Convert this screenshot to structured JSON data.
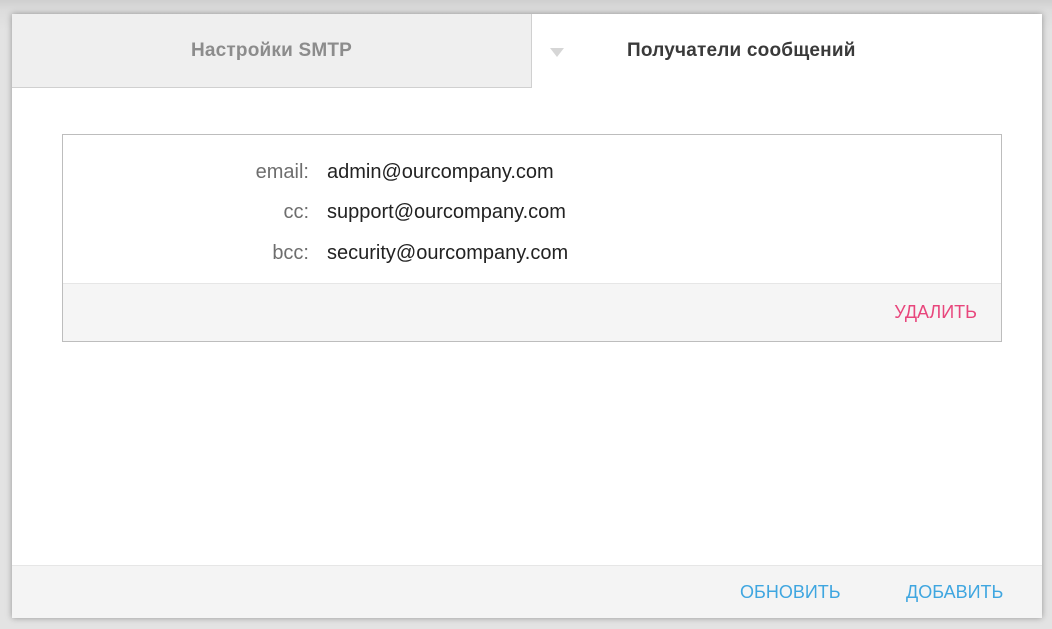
{
  "tabs": {
    "smtp_label": "Настройки SMTP",
    "recipients_label": "Получатели сообщений",
    "active": "recipients",
    "arrow_icon": "triangle-down-icon"
  },
  "recipient": {
    "fields": [
      {
        "key": "email:",
        "value": "admin@ourcompany.com"
      },
      {
        "key": "cc:",
        "value": "support@ourcompany.com"
      },
      {
        "key": "bcc:",
        "value": "security@ourcompany.com"
      }
    ],
    "delete_label": "УДАЛИТЬ"
  },
  "footer": {
    "refresh_label": "ОБНОВИТЬ",
    "add_label": "ДОБАВИТЬ"
  },
  "colors": {
    "delete": "#e8467c",
    "action": "#3fa6e0",
    "inactive_tab_bg": "#efefef"
  }
}
